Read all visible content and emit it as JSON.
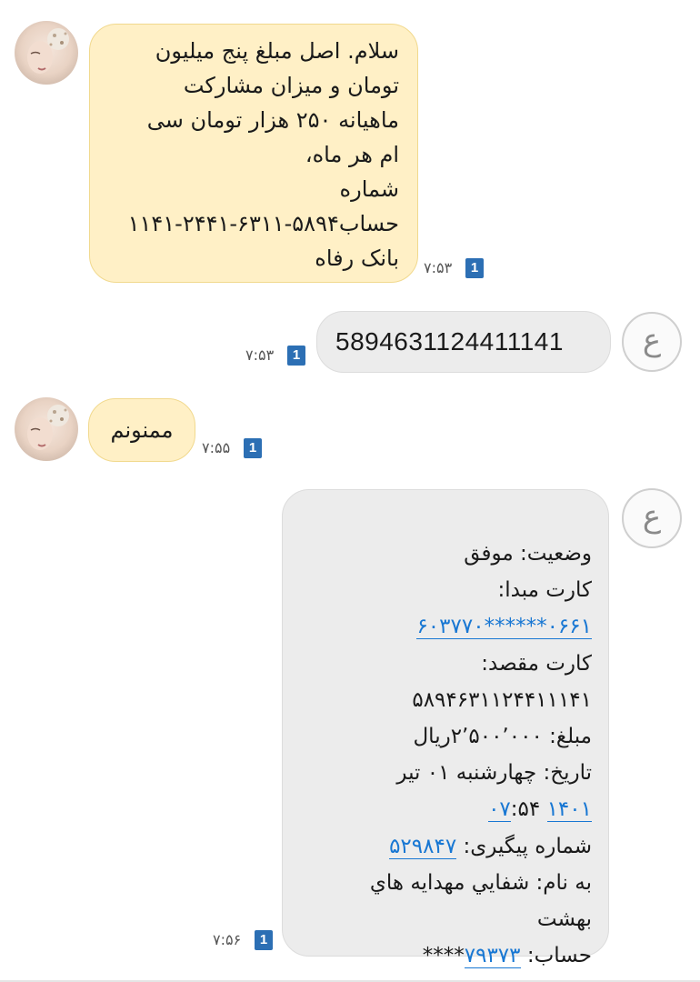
{
  "conversation": {
    "messages": [
      {
        "direction": "incoming",
        "text": "سلام. اصل مبلغ پنج میلیون\nتومان و میزان مشارکت\nماهیانه ۲۵۰ هزار  تومان سی\nام هر ماه،\nشماره\nحساب۵۸۹۴-۶۳۱۱-۲۴۴۱-۱۱۴۱\nبانک رفاه",
        "time": "۷:۵۳",
        "sim": "1"
      },
      {
        "direction": "outgoing",
        "text": "5894631124411141",
        "time": "۷:۵۳",
        "sim": "1",
        "contact_initial": "ع"
      },
      {
        "direction": "incoming",
        "text": "ممنونم",
        "time": "۷:۵۵",
        "sim": "1"
      },
      {
        "direction": "outgoing",
        "contact_initial": "ع",
        "time": "۷:۵۶",
        "sim": "1",
        "receipt": {
          "status": "وضعیت: موفق",
          "source_label": "کارت مبدا:",
          "source_card_link": "۶۰۳۷۷۰******۰۶۶۱",
          "dest_label": "کارت مقصد:",
          "dest_card": "۵۸۹۴۶۳۱۱۲۴۴۱۱۱۴۱",
          "amount": "مبلغ: ۲٬۵۰۰٬۰۰۰ریال",
          "date_prefix": "تاریخ: چهارشنبه ۰۱ تیر",
          "date_year_link": "۱۴۰۱",
          "time_link": "۰۷",
          "time_rest": ":۵۴",
          "tracking_label": "شماره پیگیری:",
          "tracking_link": "۵۲۹۸۴۷",
          "name_line1": "به نام: شفايي مهدايه هاي",
          "name_line2": "بهشت",
          "account_label": "حساب:",
          "account_link": "۷۹۳۷۳",
          "account_suffix": "****"
        }
      }
    ]
  },
  "colors": {
    "incoming_bubble": "#fff0c6",
    "outgoing_bubble": "#ececec",
    "sim_badge": "#2c6fb4",
    "link": "#1877d3"
  },
  "icons": {
    "avatar": "sender-avatar",
    "contact": "contact-initial-circle",
    "sim": "sim-1-badge"
  }
}
